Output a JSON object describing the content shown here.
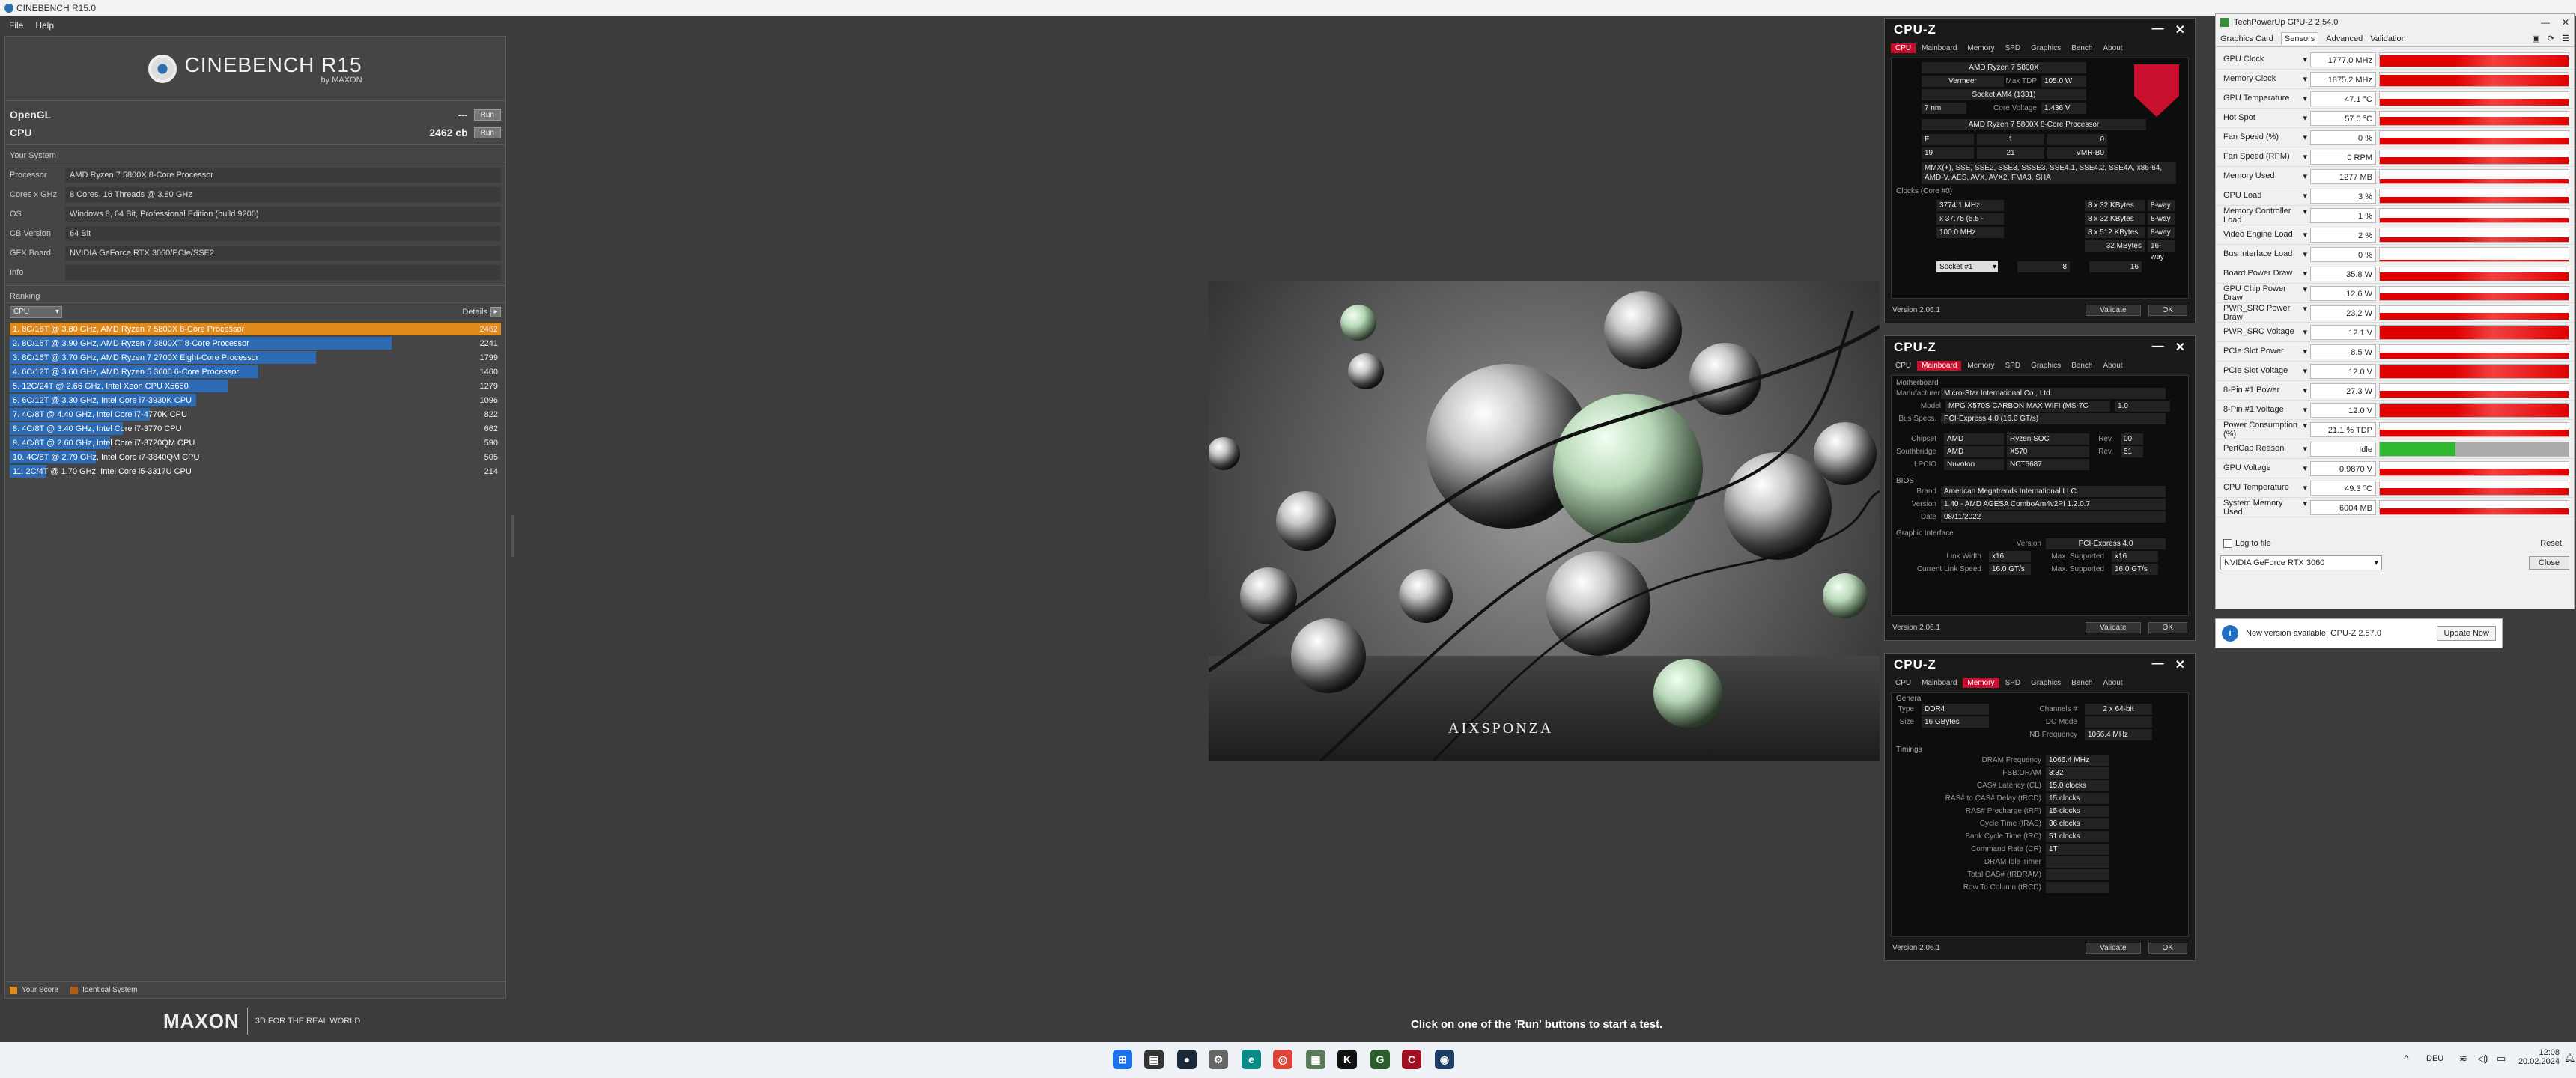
{
  "cinebench": {
    "window_title": "CINEBENCH R15.0",
    "menu": [
      "File",
      "Help"
    ],
    "logo_text": "CINEBENCH R15",
    "logo_sub": "by MAXON",
    "opengl": {
      "label": "OpenGL",
      "value": "---",
      "button": "Run"
    },
    "cpu": {
      "label": "CPU",
      "value": "2462 cb",
      "button": "Run"
    },
    "your_system_title": "Your System",
    "system": [
      {
        "key": "Processor",
        "value": "AMD Ryzen 7 5800X 8-Core Processor"
      },
      {
        "key": "Cores x GHz",
        "value": "8 Cores, 16 Threads @ 3.80 GHz"
      },
      {
        "key": "OS",
        "value": "Windows 8, 64 Bit, Professional Edition (build 9200)"
      },
      {
        "key": "CB Version",
        "value": "64 Bit"
      },
      {
        "key": "GFX Board",
        "value": "NVIDIA GeForce RTX 3060/PCIe/SSE2"
      },
      {
        "key": "Info",
        "value": ""
      }
    ],
    "ranking_title": "Ranking",
    "ranking_select": "CPU",
    "details_label": "Details",
    "ranking_max": 2462,
    "ranking": [
      {
        "label": "1. 8C/16T @ 3.80 GHz, AMD Ryzen 7 5800X 8-Core Processor",
        "score": 2462,
        "highlight": true
      },
      {
        "label": "2. 8C/16T @ 3.90 GHz, AMD Ryzen 7 3800XT 8-Core Processor",
        "score": 2241,
        "highlight": false
      },
      {
        "label": "3. 8C/16T @ 3.70 GHz, AMD Ryzen 7 2700X Eight-Core Processor",
        "score": 1799,
        "highlight": false
      },
      {
        "label": "4. 6C/12T @ 3.60 GHz, AMD Ryzen 5 3600 6-Core Processor",
        "score": 1460,
        "highlight": false
      },
      {
        "label": "5. 12C/24T @ 2.66 GHz, Intel Xeon CPU X5650",
        "score": 1279,
        "highlight": false
      },
      {
        "label": "6. 6C/12T @ 3.30 GHz,  Intel Core i7-3930K CPU",
        "score": 1096,
        "highlight": false
      },
      {
        "label": "7. 4C/8T @ 4.40 GHz, Intel Core i7-4770K CPU",
        "score": 822,
        "highlight": false
      },
      {
        "label": "8. 4C/8T @ 3.40 GHz,  Intel Core i7-3770 CPU",
        "score": 662,
        "highlight": false
      },
      {
        "label": "9. 4C/8T @ 2.60 GHz, Intel Core i7-3720QM CPU",
        "score": 590,
        "highlight": false
      },
      {
        "label": "10. 4C/8T @ 2.79 GHz,  Intel Core i7-3840QM CPU",
        "score": 505,
        "highlight": false
      },
      {
        "label": "11. 2C/4T @ 1.70 GHz,  Intel Core i5-3317U CPU",
        "score": 214,
        "highlight": false
      }
    ],
    "legend": {
      "your_score": "Your Score",
      "identical": "Identical System"
    },
    "maxon": "MAXON",
    "tagline": "3D FOR THE REAL WORLD",
    "status": "Click on one of the 'Run' buttons to start a test.",
    "render_watermark": "AIXSPONZA"
  },
  "cpuz_tabs": [
    "CPU",
    "Mainboard",
    "Memory",
    "SPD",
    "Graphics",
    "Bench",
    "About"
  ],
  "cpuz_title": "CPU-Z",
  "cpuz_version": "Version 2.06.1",
  "cpuz_validate": "Validate",
  "cpuz_ok": "OK",
  "cpuz1": {
    "name": "AMD Ryzen 7 5800X",
    "codename": "Vermeer",
    "max_tdp_label": "Max TDP",
    "max_tdp": "105.0 W",
    "package": "Socket AM4 (1331)",
    "tech": "7 nm",
    "core_voltage_label": "Core Voltage",
    "core_voltage": "1.436 V",
    "spec": "AMD Ryzen 7 5800X 8-Core Processor",
    "family": "F",
    "model": "1",
    "stepping": "0",
    "ext_family": "19",
    "ext_model": "21",
    "revision": "VMR-B0",
    "instructions": "MMX(+), SSE, SSE2, SSE3, SSSE3, SSE4.1, SSE4.2, SSE4A, x86-64, AMD-V, AES, AVX, AVX2, FMA3, SHA",
    "clocks_title": "Clocks (Core #0)",
    "core_speed": "3774.1 MHz",
    "multiplier": "x 37.75 (5.5 - 48.5)",
    "bus_speed": "100.0 MHz",
    "l1d": "8 x 32 KBytes",
    "l1d_way": "8-way",
    "l1i": "8 x 32 KBytes",
    "l1i_way": "8-way",
    "l2": "8 x 512 KBytes",
    "l2_way": "8-way",
    "l3": "32 MBytes",
    "l3_way": "16-way",
    "socket_select": "Socket #1",
    "cores": "8",
    "threads": "16"
  },
  "cpuz2": {
    "mb_title": "Motherboard",
    "manufacturer_label": "Manufacturer",
    "manufacturer": "Micro-Star International Co., Ltd.",
    "model_label": "Model",
    "model": "MPG X570S CARBON MAX WIFI (MS-7C",
    "model_rev": "1.0",
    "bus_specs_label": "Bus Specs.",
    "bus_specs": "PCI-Express 4.0 (16.0 GT/s)",
    "chipset_label": "Chipset",
    "chipset_vendor": "AMD",
    "chipset": "Ryzen SOC",
    "chipset_rev_label": "Rev.",
    "chipset_rev": "00",
    "southbridge_label": "Southbridge",
    "sb_vendor": "AMD",
    "sb": "X570",
    "sb_rev": "51",
    "lpcio_label": "LPCIO",
    "lpcio_vendor": "Nuvoton",
    "lpcio": "NCT6687",
    "bios_title": "BIOS",
    "brand_label": "Brand",
    "brand": "American Megatrends International LLC.",
    "version_label": "Version",
    "bios_version": "1.40 - AMD AGESA ComboAm4v2PI 1.2.0.7",
    "date_label": "Date",
    "bios_date": "08/11/2022",
    "gi_title": "Graphic Interface",
    "gi_version_label": "Version",
    "gi_version": "PCI-Express 4.0",
    "link_width_label": "Link Width",
    "link_width": "x16",
    "max_supported_label": "Max. Supported",
    "max_width": "x16",
    "link_speed_label": "Current Link Speed",
    "link_speed": "16.0 GT/s",
    "max_speed": "16.0 GT/s"
  },
  "cpuz3": {
    "general": "General",
    "type_label": "Type",
    "type": "DDR4",
    "size_label": "Size",
    "size": "16 GBytes",
    "channels_label": "Channels #",
    "channels": "2 x 64-bit",
    "dc_mode_label": "DC Mode",
    "nb_freq_label": "NB Frequency",
    "nb_freq": "1066.4 MHz",
    "timings": "Timings",
    "rows": [
      {
        "k": "DRAM Frequency",
        "v": "1066.4 MHz"
      },
      {
        "k": "FSB:DRAM",
        "v": "3:32"
      },
      {
        "k": "CAS# Latency (CL)",
        "v": "15.0 clocks"
      },
      {
        "k": "RAS# to CAS# Delay (tRCD)",
        "v": "15 clocks"
      },
      {
        "k": "RAS# Precharge (tRP)",
        "v": "15 clocks"
      },
      {
        "k": "Cycle Time (tRAS)",
        "v": "36 clocks"
      },
      {
        "k": "Bank Cycle Time (tRC)",
        "v": "51 clocks"
      },
      {
        "k": "Command Rate (CR)",
        "v": "1T"
      },
      {
        "k": "DRAM Idle Timer",
        "v": ""
      },
      {
        "k": "Total CAS# (tRDRAM)",
        "v": ""
      },
      {
        "k": "Row To Column (tRCD)",
        "v": ""
      }
    ]
  },
  "gpuz": {
    "title": "TechPowerUp GPU-Z 2.54.0",
    "tabs": [
      "Graphics Card",
      "Sensors",
      "Advanced",
      "Validation"
    ],
    "sensors": [
      {
        "name": "GPU Clock",
        "value": "1777.0 MHz",
        "level": 0.78
      },
      {
        "name": "Memory Clock",
        "value": "1875.2 MHz",
        "level": 0.78
      },
      {
        "name": "GPU Temperature",
        "value": "47.1 °C",
        "level": 0.5
      },
      {
        "name": "Hot Spot",
        "value": "57.0 °C",
        "level": 0.6
      },
      {
        "name": "Fan Speed (%)",
        "value": "0 %",
        "level": 0.5
      },
      {
        "name": "Fan Speed (RPM)",
        "value": "0 RPM",
        "level": 0.5
      },
      {
        "name": "Memory Used",
        "value": "1277 MB",
        "level": 0.3
      },
      {
        "name": "GPU Load",
        "value": "3 %",
        "level": 0.4
      },
      {
        "name": "Memory Controller Load",
        "value": "1 %",
        "level": 0.3
      },
      {
        "name": "Video Engine Load",
        "value": "2 %",
        "level": 0.3
      },
      {
        "name": "Bus Interface Load",
        "value": "0 %",
        "level": 0.1
      },
      {
        "name": "Board Power Draw",
        "value": "35.8 W",
        "level": 0.6
      },
      {
        "name": "GPU Chip Power Draw",
        "value": "12.6 W",
        "level": 0.5
      },
      {
        "name": "PWR_SRC Power Draw",
        "value": "23.2 W",
        "level": 0.5
      },
      {
        "name": "PWR_SRC Voltage",
        "value": "12.1 V",
        "level": 0.9
      },
      {
        "name": "PCIe Slot Power",
        "value": "8.5 W",
        "level": 0.4
      },
      {
        "name": "PCIe Slot Voltage",
        "value": "12.0 V",
        "level": 0.9
      },
      {
        "name": "8-Pin #1 Power",
        "value": "27.3 W",
        "level": 0.5
      },
      {
        "name": "8-Pin #1 Voltage",
        "value": "12.0 V",
        "level": 0.9
      },
      {
        "name": "Power Consumption (%)",
        "value": "21.1 % TDP",
        "level": 0.5
      },
      {
        "name": "PerfCap Reason",
        "value": "Idle",
        "level": 0.4
      },
      {
        "name": "GPU Voltage",
        "value": "0.9870 V",
        "level": 0.5
      },
      {
        "name": "CPU Temperature",
        "value": "49.3 °C",
        "level": 0.5
      },
      {
        "name": "System Memory Used",
        "value": "6004 MB",
        "level": 0.4
      }
    ],
    "log_to_file": "Log to file",
    "reset": "Reset",
    "device": "NVIDIA GeForce RTX 3060",
    "close": "Close",
    "notify_text": "New version available: GPU-Z 2.57.0",
    "update_now": "Update Now"
  },
  "taskbar": {
    "lang": "DEU",
    "time": "12:08",
    "date": "20.02.2024"
  }
}
